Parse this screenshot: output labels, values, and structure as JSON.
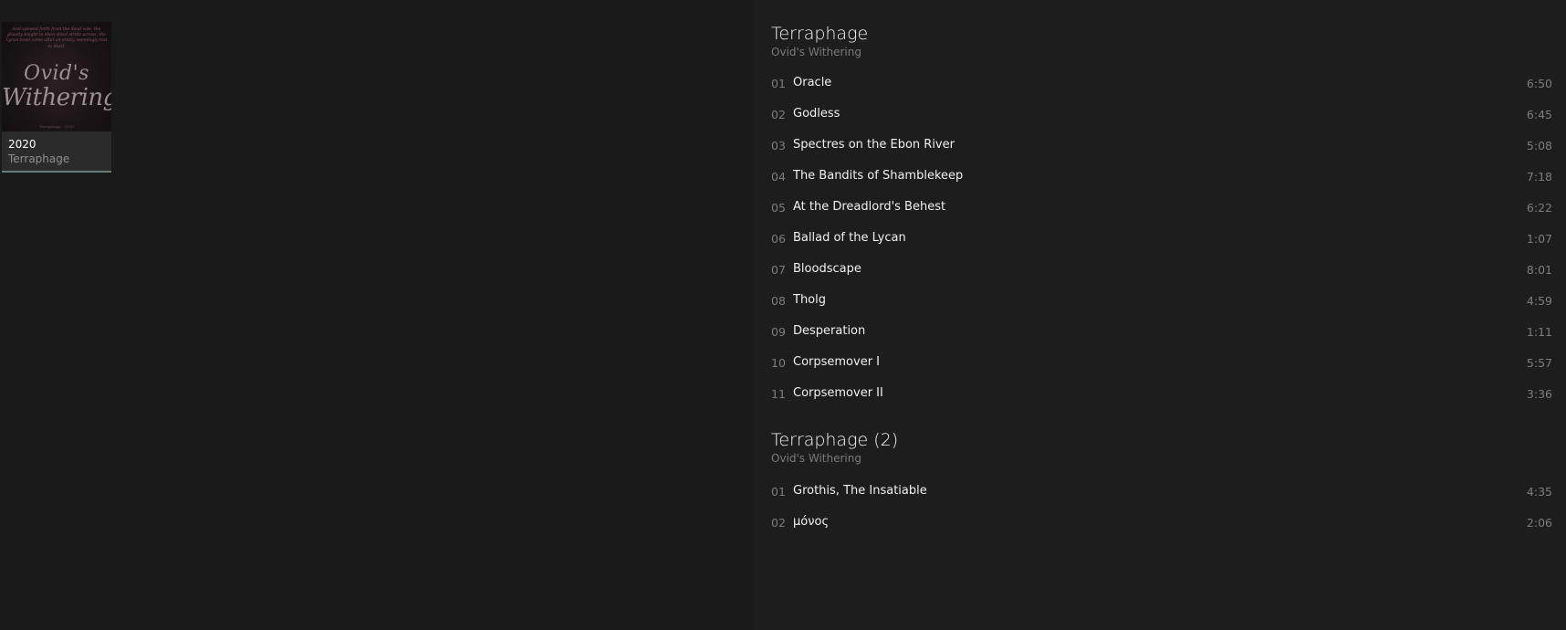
{
  "album": {
    "year": "2020",
    "artist": "Terraphage",
    "art": {
      "poem": "And spewed forth from the dead vale, the ghastly knight in ebon steed stride across, the Lycan howl come after an entity, seemingly lost to itself.",
      "logo_line1": "Ovid's",
      "logo_line2": "Withering",
      "footer": "Terraphage · 2020"
    }
  },
  "discs": [
    {
      "title": "Terraphage",
      "subtitle": "Ovid's Withering",
      "tracks": [
        {
          "num": "01",
          "title": "Oracle",
          "duration": "6:50"
        },
        {
          "num": "02",
          "title": "Godless",
          "duration": "6:45"
        },
        {
          "num": "03",
          "title": "Spectres on the Ebon River",
          "duration": "5:08"
        },
        {
          "num": "04",
          "title": "The Bandits of Shamblekeep",
          "duration": "7:18"
        },
        {
          "num": "05",
          "title": "At the Dreadlord's Behest",
          "duration": "6:22"
        },
        {
          "num": "06",
          "title": "Ballad of the Lycan",
          "duration": "1:07"
        },
        {
          "num": "07",
          "title": "Bloodscape",
          "duration": "8:01"
        },
        {
          "num": "08",
          "title": "Tholg",
          "duration": "4:59"
        },
        {
          "num": "09",
          "title": "Desperation",
          "duration": "1:11"
        },
        {
          "num": "10",
          "title": "Corpsemover I",
          "duration": "5:57"
        },
        {
          "num": "11",
          "title": "Corpsemover II",
          "duration": "3:36"
        }
      ]
    },
    {
      "title": "Terraphage (2)",
      "subtitle": "Ovid's Withering",
      "tracks": [
        {
          "num": "01",
          "title": "Grothis, The Insatiable",
          "duration": "4:35"
        },
        {
          "num": "02",
          "title": "μόνος",
          "duration": "2:06"
        }
      ]
    }
  ]
}
